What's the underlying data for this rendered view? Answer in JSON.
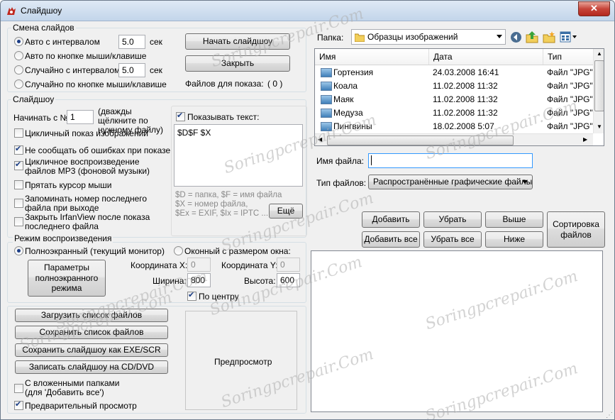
{
  "window": {
    "title": "Слайдшоу",
    "close_label": "✕"
  },
  "slide_change": {
    "title": "Смена слайдов",
    "options": [
      {
        "label": "Авто с интервалом",
        "checked": true
      },
      {
        "label": "Авто по кнопке мыши/клавише",
        "checked": false
      },
      {
        "label": "Случайно с интервалом",
        "checked": false
      },
      {
        "label": "Случайно по кнопке мыши/клавише",
        "checked": false
      }
    ],
    "interval1_value": "5.0",
    "interval2_value": "5.0",
    "unit": "сек"
  },
  "actions": {
    "start_label": "Начать слайдшоу",
    "close_label": "Закрыть",
    "files_count_label": "Файлов для показа:",
    "files_count_value": "( 0 )"
  },
  "slideshow": {
    "title": "Слайдшоу",
    "start_from_label": "Начинать с №",
    "start_from_value": "1",
    "start_from_hint": "(дважды щёлкните по нужному файлу)",
    "options": [
      {
        "label": "Цикличный показ изображений",
        "checked": false
      },
      {
        "label": "Не сообщать об ошибках при показе",
        "checked": true
      },
      {
        "label": "Цикличное воспроизведение файлов MP3 (фоновой музыки)",
        "checked": true
      },
      {
        "label": "Прятать курсор мыши",
        "checked": false
      },
      {
        "label": "Запоминать номер последнего файла при выходе",
        "checked": false
      },
      {
        "label": "Закрыть IrfanView после показа последнего файла",
        "checked": false
      }
    ],
    "show_text_label": "Показывать текст:",
    "show_text_checked": true,
    "text_value": "$D$F $X",
    "help_text": "$D = папка, $F = имя файла\n$X = номер файла,\n$Ex = EXIF, $Ix = IPTC ...",
    "more_label": "Ещё"
  },
  "playback": {
    "title": "Режим воспроизведения",
    "fullscreen_label": "Полноэкранный (текущий монитор)",
    "fullscreen_checked": true,
    "windowed_label": "Оконный с размером окна:",
    "windowed_checked": false,
    "fs_params_label": "Параметры полноэкранного режима",
    "coord_x_label": "Координата X:",
    "coord_x_value": "0",
    "coord_y_label": "Координата Y:",
    "coord_y_value": "0",
    "width_label": "Ширина:",
    "width_value": "800",
    "height_label": "Высота:",
    "height_value": "600",
    "center_label": "По центру",
    "center_checked": true
  },
  "bottom": {
    "load_list": "Загрузить список файлов",
    "save_list": "Сохранить список файлов",
    "save_exe": "Сохранить слайдшоу как EXE/SCR",
    "burn_cd": "Записать слайдшоу на CD/DVD",
    "subfolders_label": "С вложенными папками (для 'Добавить все')",
    "subfolders_checked": false,
    "preview_label": "Предварительный просмотр",
    "preview_checked": true,
    "preview_box_label": "Предпросмотр"
  },
  "browser": {
    "folder_label": "Папка:",
    "folder_value": "Образцы изображений",
    "columns": [
      "Имя",
      "Дата",
      "Тип"
    ],
    "files": [
      {
        "name": "Гортензия",
        "date": "24.03.2008 16:41",
        "type": "Файл \"JPG\""
      },
      {
        "name": "Коала",
        "date": "11.02.2008 11:32",
        "type": "Файл \"JPG\""
      },
      {
        "name": "Маяк",
        "date": "11.02.2008 11:32",
        "type": "Файл \"JPG\""
      },
      {
        "name": "Медуза",
        "date": "11.02.2008 11:32",
        "type": "Файл \"JPG\""
      },
      {
        "name": "Пингвины",
        "date": "18.02.2008 5:07",
        "type": "Файл \"JPG\""
      }
    ],
    "filename_label": "Имя файла:",
    "filename_value": "",
    "filetype_label": "Тип файлов:",
    "filetype_value": "Распространённые графические файлы"
  },
  "list_buttons": {
    "add": "Добавить",
    "remove": "Убрать",
    "up": "Выше",
    "add_all": "Добавить все",
    "remove_all": "Убрать все",
    "down": "Ниже",
    "sort": "Сортировка файлов"
  },
  "watermark": "Soringpcrepair.Com",
  "colors": {
    "accent": "#3399ff",
    "close": "#c7453a",
    "selection": "#1b3d86"
  }
}
